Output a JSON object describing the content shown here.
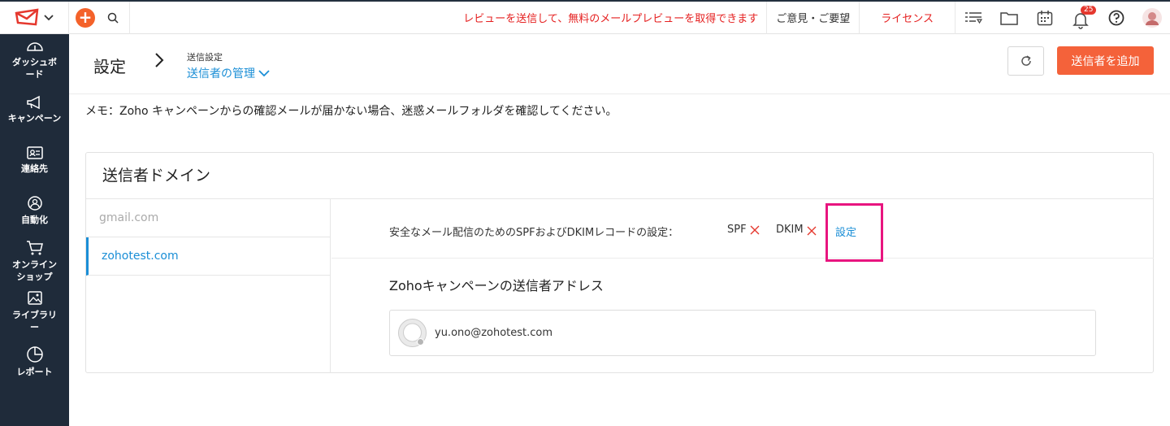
{
  "topbar": {
    "promo": "レビューを送信して、無料のメールプレビューを取得できます",
    "feedback": "ご意見・ご要望",
    "license": "ライセンス",
    "notification_count": "25"
  },
  "sidebar": {
    "items": [
      {
        "label": "ダッシュボード",
        "icon": "dashboard-icon"
      },
      {
        "label": "キャンペーン",
        "icon": "megaphone-icon"
      },
      {
        "label": "連絡先",
        "icon": "contact-card-icon"
      },
      {
        "label": "自動化",
        "icon": "automation-icon"
      },
      {
        "label": "オンラインショップ",
        "icon": "cart-icon"
      },
      {
        "label": "ライブラリー",
        "icon": "image-library-icon"
      },
      {
        "label": "レポート",
        "icon": "pie-chart-icon"
      }
    ]
  },
  "header": {
    "title": "設定",
    "breadcrumb_parent": "送信設定",
    "breadcrumb_current": "送信者の管理",
    "add_button": "送信者を追加"
  },
  "memo": "メモ：Zoho キャンペーンからの確認メールが届かない場合、迷惑メールフォルダを確認してください。",
  "panel": {
    "title": "送信者ドメイン",
    "domains": [
      "gmail.com",
      "zohotest.com"
    ],
    "selected_domain": "zohotest.com",
    "spf_text": "安全なメール配信のためのSPFおよびDKIMレコードの設定：",
    "spf_label": "SPF",
    "dkim_label": "DKIM",
    "settings_link": "設定",
    "sender_section_title": "Zohoキャンペーンの送信者アドレス",
    "sender_email": "yu.ono@zohotest.com"
  },
  "colors": {
    "accent": "#f4623a",
    "link": "#1a8ed6",
    "sidebar_bg": "#1f2b3a",
    "error": "#e52020",
    "highlight": "#e8157f"
  }
}
